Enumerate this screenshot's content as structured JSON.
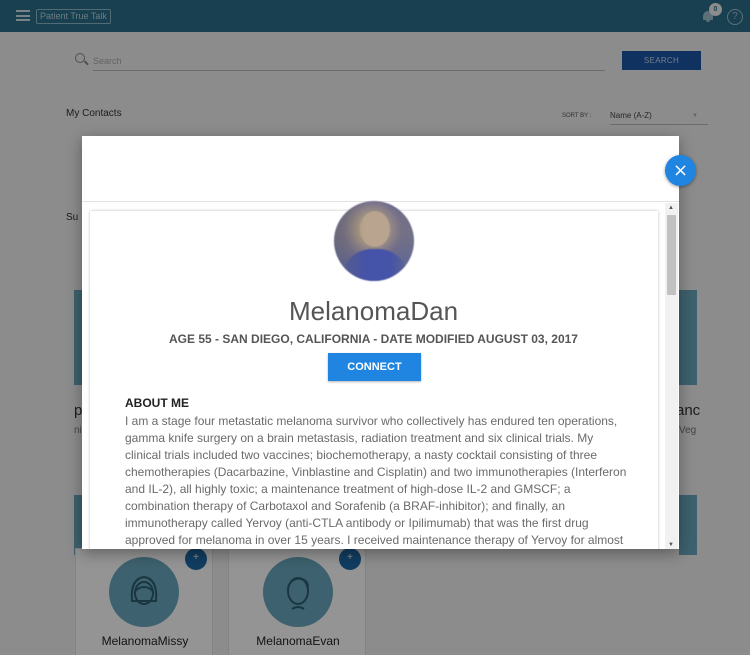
{
  "header": {
    "logo_text": "Patient True Talk",
    "notification_count": "0",
    "help_symbol": "?"
  },
  "search": {
    "placeholder": "Search",
    "button_label": "SEARCH"
  },
  "contacts": {
    "title": "My Contacts",
    "sort_label": "SORT BY :",
    "sort_value": "Name (A-Z)"
  },
  "background_fragments": {
    "section_initial": "Su",
    "left_name_fragment": "ph",
    "left_sub_fragment": "ni",
    "right_name_fragment": "anc",
    "right_sub_fragment": "Veg"
  },
  "cards": [
    {
      "name": "MelanomaMissy",
      "sub": ""
    },
    {
      "name": "MelanomaEvan",
      "sub": ""
    }
  ],
  "modal": {
    "close_symbol": "×",
    "profile_name": "MelanomaDan",
    "profile_meta": "AGE 55 - SAN DIEGO, CALIFORNIA - DATE MODIFIED AUGUST 03, 2017",
    "connect_label": "CONNECT",
    "about_title": "ABOUT ME",
    "about_text": "I am a stage four metastatic melanoma survivor who collectively has endured ten operations, gamma knife surgery on a brain metastasis, radiation treatment and six clinical trials. My clinical trials included two vaccines; biochemotherapy, a nasty cocktail consisting of three chemotherapies (Dacarbazine, Vinblastine and Cisplatin) and two immunotherapies (Interferon and IL-2), all highly toxic; a maintenance treatment of high-dose IL-2 and GMSCF; a combination therapy of Carbotaxol and Sorafenib (a BRAF-inhibitor); and finally, an immunotherapy called Yervoy (anti-CTLA antibody or Ipilimumab) that was the first drug approved for melanoma in over 15 years. I received maintenance therapy of Yervoy for almost",
    "scroll_up": "▲",
    "scroll_down": "▼"
  },
  "colors": {
    "topbar": "#2b6f8a",
    "search_button": "#1a56a8",
    "accent": "#1f85e0",
    "avatar_tile": "#6aa7be"
  }
}
